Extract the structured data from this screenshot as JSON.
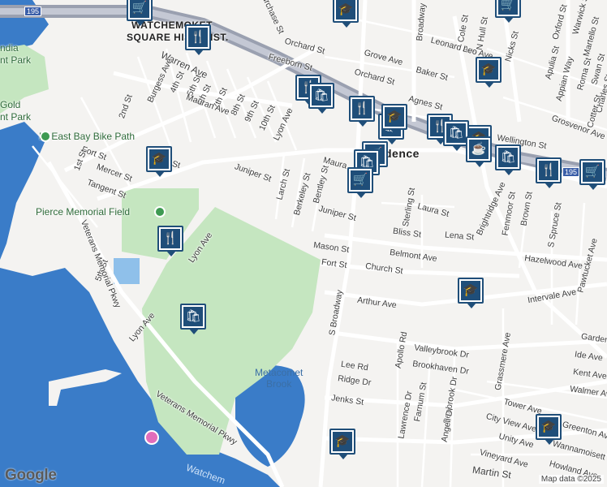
{
  "map": {
    "colors": {
      "land": "#f4f3f1",
      "water": "#3a7cc8",
      "park": "#c5e6c0",
      "highway": "#9aa0b0",
      "road": "#ffffff",
      "marker": "#1f4e79"
    },
    "street_labels": [
      "Purchase St",
      "Orchard St",
      "Freeborn St",
      "Grove Ave",
      "Orchard St",
      "Baker St",
      "Broadway",
      "Cole St",
      "N Hull St",
      "Leonard Ave",
      "Warren Ave",
      "Burgess Ave",
      "4th St",
      "5th St",
      "6th St",
      "7th St",
      "8th St",
      "9th St",
      "10th St",
      "Lyon Ave",
      "Mauran Ave",
      "2nd St",
      "Fort St",
      "1st St",
      "Mercer St",
      "Tangent St",
      "Juniper St",
      "Larch St",
      "Berkeley St",
      "Bentley St",
      "Maura",
      "Agnes St",
      "Wellington St",
      "Grosvenor Ave",
      "Laura St",
      "Sterling St",
      "Juniper St",
      "Bliss St",
      "Lena St",
      "Mason St",
      "Belmont Ave",
      "Fort St",
      "Church St",
      "Hazelwood Ave",
      "Brightridge Ave",
      "Fenmoor St",
      "Brown St",
      "S Spruce St",
      "Arthur Ave",
      "Intervale Ave",
      "S Broadway",
      "Apollo Rd",
      "Valleybrook Dr",
      "Lee Rd",
      "Brookhaven Dr",
      "Ridge Dr",
      "Jenks St",
      "Lawrence Dr",
      "Farnum St",
      "Seabrook Dr",
      "Angell Dr",
      "Grassmere Ave",
      "Tower Ave",
      "City View Ave",
      "Unity Ave",
      "Vineyard Ave",
      "Martin St",
      "Ide Ave",
      "Kent Ave",
      "Walmer Ave",
      "Garden",
      "Howland Ave",
      "Wannamoisett",
      "Greenton Ave",
      "Pawtucket Ave",
      "Lyon Ave",
      "Lyon Ave",
      "5th St",
      "Veterans Memorial Pkwy",
      "Veterans Memorial Pkwy",
      "Warwick St",
      "Oxford St",
      "Martello St",
      "Apulia St",
      "Appian Way",
      "Roma St",
      "Swan St",
      "Charles St",
      "Cotter St",
      "Nicks St",
      "Leo Ave",
      "St"
    ],
    "area_labels": [
      "WATCHEMOKET",
      "SQUARE HIST. DIST.",
      "ndia",
      "nt Park",
      "Gold",
      "nt Park",
      "dence"
    ],
    "poi_labels": [
      "RI East Bay Bike Path",
      "Pierce Memorial Field"
    ],
    "water_labels": [
      "Metacomet",
      "Brook",
      "Watchem"
    ],
    "highway_shields": [
      "195",
      "195"
    ],
    "attribution": "Map data ©2025",
    "logo": "Google",
    "markers": [
      "grocery",
      "school",
      "grocery",
      "school",
      "restaurant",
      "school",
      "restaurant",
      "shopping",
      "restaurant",
      "shopping",
      "restaurant",
      "school",
      "school",
      "shopping",
      "grocery",
      "shopping",
      "cafe",
      "shopping",
      "grocery",
      "restaurant",
      "grocery",
      "restaurant",
      "shopping",
      "school",
      "school",
      "school"
    ]
  }
}
